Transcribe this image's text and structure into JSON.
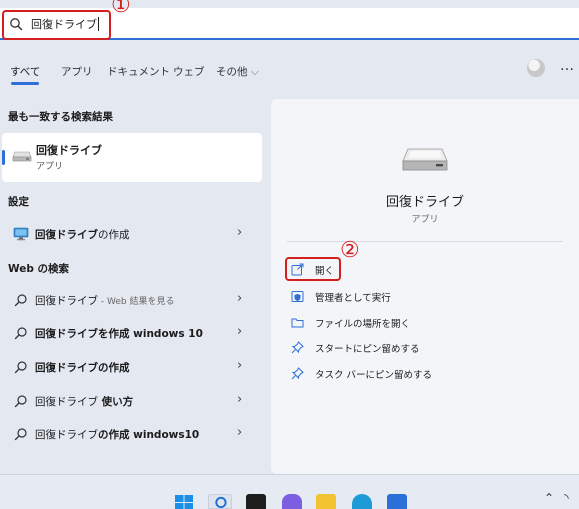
{
  "search": {
    "query": "回復ドライブ",
    "icon": "search-icon"
  },
  "annotations": {
    "first": "①",
    "second": "②"
  },
  "filters": {
    "items": [
      "すべて",
      "アプリ",
      "ドキュメント",
      "ウェブ",
      "その他"
    ],
    "more_chevron": "⌵",
    "more_menu": "…"
  },
  "best_match": {
    "heading": "最も一致する検索結果",
    "title": "回復ドライブ",
    "subtitle": "アプリ"
  },
  "settings": {
    "heading": "設定",
    "item_bold": "回復ドライブ",
    "item_rest": "の作成"
  },
  "web": {
    "heading": "Web の検索",
    "results": [
      {
        "bold": "",
        "normal": "回復ドライブ",
        "suffix": " - Web 結果を見る"
      },
      {
        "bold": "回復ドライブを作成 windows 10",
        "normal": "",
        "suffix": ""
      },
      {
        "bold": "回復ドライブの作成",
        "normal": "",
        "suffix": ""
      },
      {
        "bold": "",
        "normal": "回復ドライブ",
        "boldtail": " 使い方"
      },
      {
        "bold": "",
        "normal": "回復ドライブ",
        "boldtail": "の作成 windows10"
      }
    ]
  },
  "detail": {
    "title": "回復ドライブ",
    "subtitle": "アプリ",
    "actions": [
      {
        "label": "開く",
        "icon": "open-external-icon"
      },
      {
        "label": "管理者として実行",
        "icon": "admin-shield-icon"
      },
      {
        "label": "ファイルの場所を開く",
        "icon": "folder-icon"
      },
      {
        "label": "スタートにピン留めする",
        "icon": "pin-icon"
      },
      {
        "label": "タスク バーにピン留めする",
        "icon": "pin-icon"
      }
    ]
  },
  "colors": {
    "accent": "#2f6fd8",
    "annotation": "#d41f1f"
  },
  "chevron": "›"
}
